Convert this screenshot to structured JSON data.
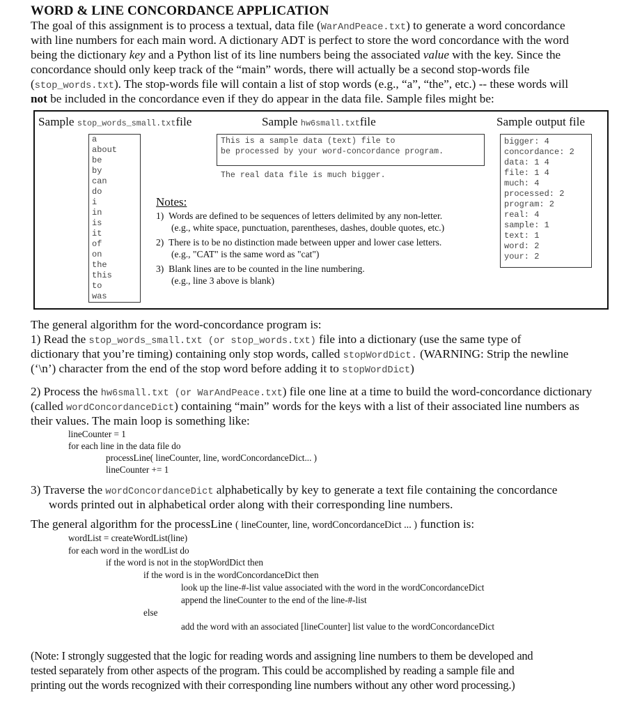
{
  "title": "WORD & LINE CONCORDANCE APPLICATION",
  "intro": {
    "l1a": "The goal of this assignment is to process a textual, data file (",
    "l1b": "WarAndPeace.txt",
    "l1c": ") to generate a word concordance",
    "l2": "with line numbers for each main word.  A dictionary ADT is perfect to store the word concordance with the word",
    "l3a": "being the dictionary ",
    "l3b": "key",
    "l3c": " and a Python list of its line numbers being the associated ",
    "l3d": "value",
    "l3e": " with the key. Since the",
    "l4": "concordance should only keep track of the “main” words, there will actually be a second stop-words file",
    "l5a": "(",
    "l5b": "stop_words.txt",
    "l5c": ").  The stop-words file will contain a list of stop words (e.g., “a”, “the”, etc.) -- these words will",
    "l6a": "not",
    "l6b": " be included in the concordance even if they do appear in the data file.   Sample files might be:"
  },
  "samples": {
    "stop_header_a": "Sample ",
    "stop_header_b": "stop_words_small.txt",
    "stop_header_c": "file",
    "stop_words": [
      "a",
      "about",
      "be",
      "by",
      "can",
      "do",
      "i",
      "in",
      "is",
      "it",
      "of",
      "on",
      "the",
      "this",
      "to",
      "was"
    ],
    "data_header_a": "Sample ",
    "data_header_b": "hw6small.txt",
    "data_header_c": "file",
    "data_lines": [
      "This is a sample data (text) file to",
      "be processed by your word-concordance program.",
      "",
      "The real data file is much bigger."
    ],
    "output_header": "Sample output file",
    "output_lines": [
      "bigger: 4",
      "concordance: 2",
      "data: 1 4",
      "file: 1 4",
      "much: 4",
      "processed: 2",
      "program: 2",
      "real: 4",
      "sample: 1",
      "text: 1",
      "word: 2",
      "your: 2"
    ],
    "notes_title": "Notes:",
    "notes": [
      {
        "num": "1)",
        "line1": "Words are defined to be sequences of letters delimited by any non-letter.",
        "line2": "(e.g., white space, punctuation, parentheses, dashes, double quotes, etc.)"
      },
      {
        "num": "2)",
        "line1": "There is to be no distinction made between upper and lower case letters.",
        "line2": "(e.g., \"CAT\" is the same word as \"cat\")"
      },
      {
        "num": "3)",
        "line1": "Blank lines are to be counted in the line numbering.",
        "line2": "(e.g., line 3 above is blank)"
      }
    ]
  },
  "algorithm": {
    "heading": "The general algorithm for the word-concordance program is:",
    "step1": {
      "a": "1)  Read the ",
      "b": "stop_words_small.txt (or stop_words.txt)",
      "c": " file into a dictionary (use the same type of",
      "l2a": "dictionary that you’re timing) containing only stop words, called ",
      "l2b": "stopWordDict.",
      "l2c": "  (WARNING: Strip the newline",
      "l3a": "(‘\\n’) character from the end of the stop word before adding it to ",
      "l3b": "stopWordDict",
      "l3c": ")"
    },
    "step2": {
      "a": "2)  Process the ",
      "b": "hw6small.txt (or WarAndPeace.txt",
      "c": ") file one line at a time to build the word-concordance dictionary",
      "l2a": "(called ",
      "l2b": "wordConcordanceDict",
      "l2c": ") containing “main” words for the keys with a list of their associated line numbers as",
      "l3": "their values.  The main loop is something like:",
      "code": [
        "lineCounter = 1",
        "for each line in the data file do",
        "processLine( lineCounter, line, wordConcordanceDict... )",
        "lineCounter += 1"
      ]
    },
    "step3": {
      "a": "3)  Traverse the ",
      "b": "wordConcordanceDict",
      "c": " alphabetically by key to generate a text file containing the concordance",
      "l2": "words printed out in alphabetical order along with their corresponding line numbers."
    }
  },
  "process_line": {
    "heading_a": "The general algorithm for the processLine ",
    "heading_b": "( lineCounter, line, wordConcordanceDict ... )",
    "heading_c": "  function is:",
    "code": [
      "wordList = createWordList(line)",
      "for each word in the wordList do",
      "if the word is not in the stopWordDict then",
      "if the word is in the wordConcordanceDict then",
      "look up the line-#-list value associated with the word in the wordConcordanceDict",
      "append the lineCounter to the end of the line-#-list",
      "else",
      "add the word with an associated [lineCounter] list value to the wordConcordanceDict"
    ]
  },
  "final_note": [
    "(Note:  I strongly suggested that the logic for reading words and assigning line numbers to them be developed and",
    "tested separately from other aspects of the program.  This could be accomplished by reading a sample file and",
    "printing out the words recognized with their corresponding line numbers without any other word processing.)"
  ]
}
